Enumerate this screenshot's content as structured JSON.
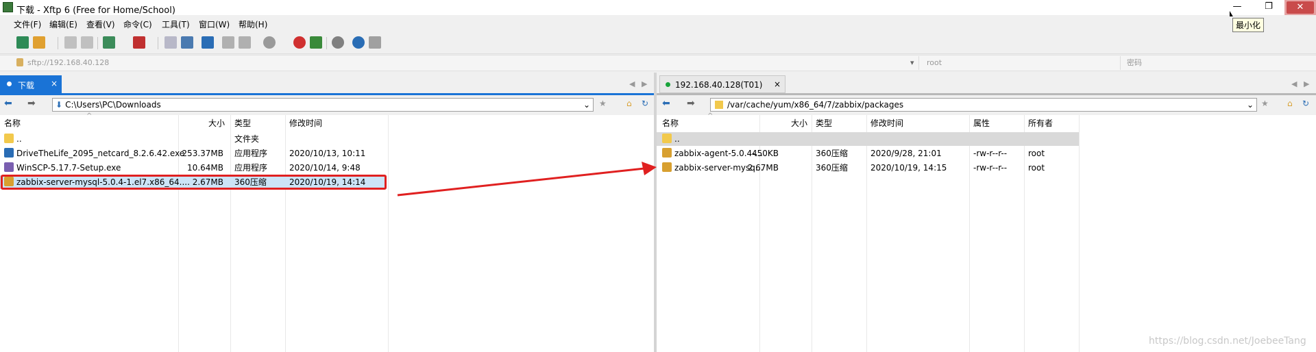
{
  "window": {
    "title": "下载 - Xftp 6 (Free for Home/School)",
    "minimize": "—",
    "restore": "❐",
    "close": "✕",
    "tooltip": "最小化"
  },
  "menu": [
    "文件(F)",
    "编辑(E)",
    "查看(V)",
    "命令(C)",
    "工具(T)",
    "窗口(W)",
    "帮助(H)"
  ],
  "address": {
    "host": "sftp://192.168.40.128",
    "user": "root",
    "password_placeholder": "密码"
  },
  "left": {
    "tab": "下载",
    "path": "C:\\Users\\PC\\Downloads",
    "columns": {
      "name": "名称",
      "size": "大小",
      "type": "类型",
      "modified": "修改时间"
    },
    "rows": [
      {
        "name": "..",
        "size": "",
        "type": "文件夹",
        "modified": ""
      },
      {
        "name": "DriveTheLife_2095_netcard_8.2.6.42.exe",
        "size": "253.37MB",
        "type": "应用程序",
        "modified": "2020/10/13, 10:11"
      },
      {
        "name": "WinSCP-5.17.7-Setup.exe",
        "size": "10.64MB",
        "type": "应用程序",
        "modified": "2020/10/14, 9:48"
      },
      {
        "name": "zabbix-server-mysql-5.0.4-1.el7.x86_64....",
        "size": "2.67MB",
        "type": "360压缩",
        "modified": "2020/10/19, 14:14"
      }
    ]
  },
  "right": {
    "tab": "192.168.40.128(T01)",
    "path": "/var/cache/yum/x86_64/7/zabbix/packages",
    "columns": {
      "name": "名称",
      "size": "大小",
      "type": "类型",
      "modified": "修改时间",
      "attrs": "属性",
      "owner": "所有者"
    },
    "rows": [
      {
        "name": "..",
        "size": "",
        "type": "",
        "modified": "",
        "attrs": "",
        "owner": ""
      },
      {
        "name": "zabbix-agent-5.0.4-...",
        "size": "450KB",
        "type": "360压缩",
        "modified": "2020/9/28, 21:01",
        "attrs": "-rw-r--r--",
        "owner": "root"
      },
      {
        "name": "zabbix-server-mysq...",
        "size": "2.67MB",
        "type": "360压缩",
        "modified": "2020/10/19, 14:15",
        "attrs": "-rw-r--r--",
        "owner": "root"
      }
    ]
  },
  "watermark": "https://blog.csdn.net/JoebeeTang",
  "colors": {
    "accent": "#1a73d6",
    "highlight": "#e02020",
    "selected": "#cce4f7"
  }
}
